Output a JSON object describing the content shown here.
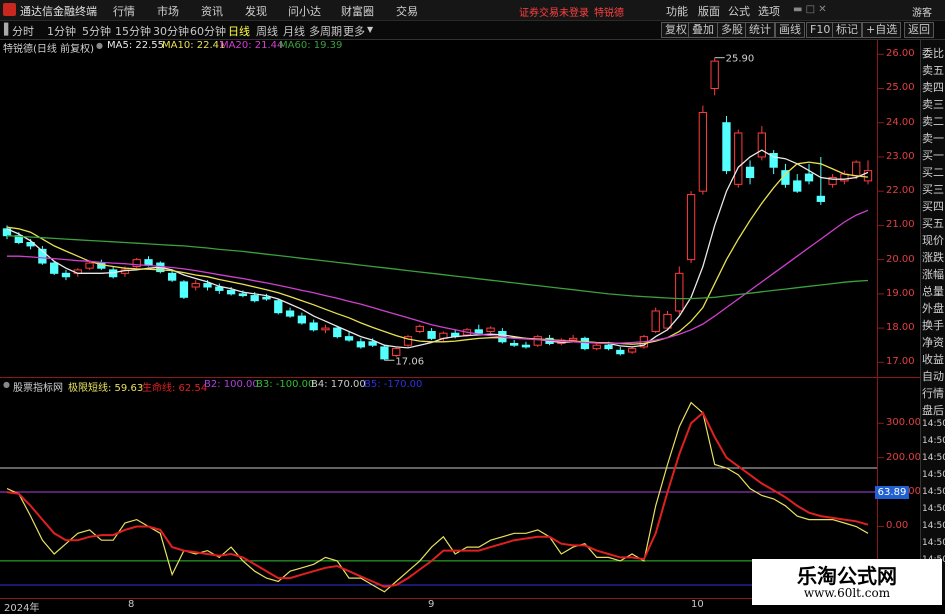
{
  "app": {
    "title": "通达信金融终端",
    "menu": [
      "行情",
      "市场",
      "资讯",
      "发现",
      "问小达",
      "财富圈",
      "交易"
    ],
    "notice": "证券交易未登录",
    "stock_name": "特锐德",
    "right_menu": [
      "功能",
      "版面",
      "公式",
      "选项"
    ],
    "guest": "游客"
  },
  "toolbar": {
    "periods": [
      "分时",
      "1分钟",
      "5分钟",
      "15分钟",
      "30分钟",
      "60分钟",
      "日线",
      "周线",
      "月线",
      "多周期",
      "更多"
    ],
    "active_period": "日线",
    "buttons": [
      "复权",
      "叠加",
      "多股",
      "统计",
      "画线",
      "F10",
      "标记",
      "+自选",
      "返回"
    ]
  },
  "main_header": {
    "title": "特锐德(日线 前复权)",
    "ma5": "MA5: 22.55",
    "ma10": "MA10: 22.41",
    "ma20": "MA20: 21.44",
    "ma60": "MA60: 19.39"
  },
  "sub_header": {
    "title": "股票指标网",
    "l1": "极限短线: 59.63",
    "l2": "生命线: 62.54",
    "l3": "B2: 100.00",
    "l4": "B3: -100.00",
    "l5": "B4: 170.00",
    "l6": "B5: -170.00"
  },
  "price_axis": [
    "26.00",
    "25.00",
    "24.00",
    "23.00",
    "22.00",
    "21.00",
    "20.00",
    "19.00",
    "18.00",
    "17.00"
  ],
  "indicator_axis": [
    "300.00",
    "200.00",
    "100.00",
    "0.00"
  ],
  "indicator_badge": "63.89",
  "time_axis": [
    "2024年",
    "8",
    "9",
    "10"
  ],
  "right_panel": [
    "委比",
    "卖五",
    "卖四",
    "卖三",
    "卖二",
    "卖一",
    "买一",
    "买二",
    "买三",
    "买四",
    "买五",
    "现价",
    "涨跌",
    "涨幅",
    "总量",
    "外盘",
    "换手",
    "净资",
    "收益",
    "自动",
    "行情",
    "盘后",
    "14:50",
    "14:50",
    "14:50",
    "14:50",
    "14:50",
    "14:50",
    "14:50",
    "14:50",
    "14:50"
  ],
  "price_labels": {
    "high": "25.90",
    "low": "17.06"
  },
  "watermark": {
    "title": "乐淘公式网",
    "url": "www.60lt.com"
  },
  "chart_data": [
    {
      "type": "candlestick",
      "title": "特锐德(日线 前复权)",
      "ylim": [
        16.6,
        26.3
      ],
      "x": [
        "d1",
        "d2",
        "d3",
        "d4",
        "d5",
        "d6",
        "d7",
        "d8",
        "d9",
        "d10",
        "d11",
        "d12",
        "d13",
        "d14",
        "d15",
        "d16",
        "d17",
        "d18",
        "d19",
        "d20",
        "d21",
        "d22",
        "d23",
        "d24",
        "d25",
        "d26",
        "d27",
        "d28",
        "d29",
        "d30",
        "d31",
        "d32",
        "d33",
        "d34",
        "d35",
        "d36",
        "d37",
        "d38",
        "d39",
        "d40",
        "d41",
        "d42",
        "d43",
        "d44",
        "d45",
        "d46",
        "d47",
        "d48",
        "d49",
        "d50",
        "d51",
        "d52",
        "d53",
        "d54",
        "d55",
        "d56",
        "d57",
        "d58",
        "d59",
        "d60",
        "d61",
        "d62",
        "d63",
        "d64",
        "d65",
        "d66",
        "d67",
        "d68",
        "d69",
        "d70",
        "d71",
        "d72",
        "d73",
        "d74"
      ],
      "ohlc": [
        [
          20.9,
          21.0,
          20.6,
          20.7
        ],
        [
          20.7,
          20.8,
          20.45,
          20.5
        ],
        [
          20.5,
          20.6,
          20.3,
          20.4
        ],
        [
          20.3,
          20.4,
          19.85,
          19.9
        ],
        [
          19.9,
          19.95,
          19.55,
          19.6
        ],
        [
          19.6,
          19.7,
          19.4,
          19.5
        ],
        [
          19.6,
          19.75,
          19.5,
          19.7
        ],
        [
          19.75,
          19.95,
          19.7,
          19.9
        ],
        [
          19.9,
          20.0,
          19.7,
          19.75
        ],
        [
          19.7,
          19.8,
          19.45,
          19.5
        ],
        [
          19.6,
          19.8,
          19.5,
          19.7
        ],
        [
          19.8,
          20.05,
          19.75,
          20.0
        ],
        [
          20.0,
          20.1,
          19.8,
          19.85
        ],
        [
          19.9,
          19.95,
          19.6,
          19.65
        ],
        [
          19.6,
          19.7,
          19.35,
          19.4
        ],
        [
          19.35,
          19.4,
          18.85,
          18.9
        ],
        [
          19.2,
          19.4,
          19.1,
          19.3
        ],
        [
          19.3,
          19.4,
          19.1,
          19.2
        ],
        [
          19.2,
          19.3,
          19.0,
          19.1
        ],
        [
          19.1,
          19.2,
          18.95,
          19.0
        ],
        [
          19.0,
          19.1,
          18.9,
          18.95
        ],
        [
          18.95,
          19.05,
          18.75,
          18.8
        ],
        [
          18.9,
          19.0,
          18.8,
          18.85
        ],
        [
          18.8,
          18.85,
          18.4,
          18.45
        ],
        [
          18.5,
          18.6,
          18.3,
          18.35
        ],
        [
          18.35,
          18.45,
          18.1,
          18.15
        ],
        [
          18.15,
          18.25,
          17.9,
          17.95
        ],
        [
          17.95,
          18.1,
          17.85,
          18.0
        ],
        [
          18.0,
          18.05,
          17.7,
          17.75
        ],
        [
          17.75,
          17.9,
          17.6,
          17.65
        ],
        [
          17.6,
          17.7,
          17.4,
          17.45
        ],
        [
          17.6,
          17.7,
          17.45,
          17.5
        ],
        [
          17.45,
          17.5,
          17.06,
          17.1
        ],
        [
          17.2,
          17.45,
          17.15,
          17.4
        ],
        [
          17.5,
          17.8,
          17.45,
          17.75
        ],
        [
          17.9,
          18.1,
          17.85,
          18.05
        ],
        [
          17.9,
          18.0,
          17.65,
          17.7
        ],
        [
          17.7,
          17.9,
          17.6,
          17.85
        ],
        [
          17.85,
          17.95,
          17.7,
          17.75
        ],
        [
          17.8,
          18.0,
          17.75,
          17.95
        ],
        [
          17.95,
          18.1,
          17.8,
          17.85
        ],
        [
          17.9,
          18.05,
          17.85,
          18.0
        ],
        [
          17.9,
          18.0,
          17.55,
          17.6
        ],
        [
          17.55,
          17.65,
          17.45,
          17.5
        ],
        [
          17.5,
          17.6,
          17.4,
          17.45
        ],
        [
          17.5,
          17.8,
          17.45,
          17.75
        ],
        [
          17.7,
          17.8,
          17.5,
          17.55
        ],
        [
          17.55,
          17.7,
          17.5,
          17.65
        ],
        [
          17.65,
          17.8,
          17.6,
          17.7
        ],
        [
          17.7,
          17.75,
          17.35,
          17.4
        ],
        [
          17.4,
          17.55,
          17.35,
          17.5
        ],
        [
          17.5,
          17.6,
          17.35,
          17.4
        ],
        [
          17.35,
          17.45,
          17.2,
          17.25
        ],
        [
          17.3,
          17.45,
          17.25,
          17.4
        ],
        [
          17.45,
          17.8,
          17.4,
          17.75
        ],
        [
          17.9,
          18.6,
          17.85,
          18.5
        ],
        [
          18.0,
          18.5,
          17.95,
          18.4
        ],
        [
          18.5,
          19.8,
          18.4,
          19.6
        ],
        [
          20.0,
          22.0,
          19.9,
          21.9
        ],
        [
          22.0,
          24.5,
          21.9,
          24.3
        ],
        [
          25.0,
          25.9,
          24.8,
          25.8
        ],
        [
          24.0,
          24.2,
          22.5,
          22.6
        ],
        [
          22.2,
          23.8,
          22.1,
          23.7
        ],
        [
          22.7,
          22.9,
          22.2,
          22.4
        ],
        [
          23.0,
          23.9,
          22.9,
          23.7
        ],
        [
          23.1,
          23.2,
          22.5,
          22.7
        ],
        [
          22.6,
          22.8,
          22.1,
          22.2
        ],
        [
          22.3,
          22.5,
          21.95,
          22.0
        ],
        [
          22.5,
          22.8,
          22.2,
          22.3
        ],
        [
          21.85,
          23.0,
          21.6,
          21.7
        ],
        [
          22.2,
          22.5,
          22.1,
          22.4
        ],
        [
          22.3,
          22.6,
          22.2,
          22.5
        ],
        [
          22.45,
          22.9,
          22.35,
          22.85
        ],
        [
          22.3,
          22.9,
          22.2,
          22.6
        ]
      ],
      "series": [
        {
          "name": "MA5",
          "color": "#e8e8e8",
          "values": [
            20.9,
            20.75,
            20.55,
            20.25,
            19.95,
            19.75,
            19.6,
            19.6,
            19.6,
            19.62,
            19.68,
            19.7,
            19.75,
            19.78,
            19.7,
            19.55,
            19.45,
            19.35,
            19.22,
            19.15,
            19.05,
            19.0,
            18.95,
            18.85,
            18.7,
            18.55,
            18.35,
            18.2,
            18.05,
            17.9,
            17.75,
            17.65,
            17.5,
            17.45,
            17.42,
            17.5,
            17.58,
            17.7,
            17.75,
            17.78,
            17.8,
            17.82,
            17.8,
            17.75,
            17.7,
            17.67,
            17.62,
            17.58,
            17.6,
            17.6,
            17.57,
            17.55,
            17.48,
            17.45,
            17.5,
            17.75,
            17.95,
            18.35,
            18.9,
            19.8,
            21.0,
            22.0,
            22.7,
            23.0,
            23.2,
            23.0,
            22.95,
            22.8,
            22.6,
            22.4,
            22.35,
            22.35,
            22.4,
            22.55
          ]
        },
        {
          "name": "MA10",
          "color": "#e8e050",
          "values": [
            20.95,
            20.9,
            20.8,
            20.6,
            20.4,
            20.25,
            20.1,
            19.95,
            19.85,
            19.8,
            19.75,
            19.73,
            19.72,
            19.7,
            19.68,
            19.62,
            19.55,
            19.5,
            19.42,
            19.35,
            19.28,
            19.2,
            19.12,
            19.03,
            18.92,
            18.8,
            18.68,
            18.55,
            18.42,
            18.3,
            18.15,
            18.02,
            17.9,
            17.78,
            17.68,
            17.62,
            17.6,
            17.6,
            17.62,
            17.66,
            17.7,
            17.72,
            17.72,
            17.72,
            17.7,
            17.68,
            17.66,
            17.63,
            17.62,
            17.6,
            17.58,
            17.57,
            17.55,
            17.53,
            17.55,
            17.62,
            17.72,
            17.9,
            18.2,
            18.6,
            19.3,
            20.0,
            20.6,
            21.15,
            21.65,
            22.1,
            22.5,
            22.8,
            22.85,
            22.8,
            22.65,
            22.5,
            22.45,
            22.41
          ]
        },
        {
          "name": "MA20",
          "color": "#d040d0",
          "values": [
            20.1,
            20.1,
            20.08,
            20.05,
            20.03,
            20.0,
            19.97,
            19.95,
            19.92,
            19.9,
            19.88,
            19.85,
            19.83,
            19.8,
            19.77,
            19.73,
            19.68,
            19.62,
            19.56,
            19.5,
            19.45,
            19.38,
            19.32,
            19.25,
            19.18,
            19.1,
            19.03,
            18.95,
            18.87,
            18.78,
            18.7,
            18.6,
            18.5,
            18.4,
            18.3,
            18.2,
            18.1,
            18.02,
            17.95,
            17.88,
            17.82,
            17.78,
            17.74,
            17.7,
            17.68,
            17.66,
            17.64,
            17.62,
            17.6,
            17.58,
            17.56,
            17.55,
            17.56,
            17.58,
            17.6,
            17.65,
            17.72,
            17.82,
            17.95,
            18.12,
            18.35,
            18.6,
            18.85,
            19.1,
            19.35,
            19.6,
            19.85,
            20.1,
            20.35,
            20.6,
            20.85,
            21.1,
            21.3,
            21.44
          ]
        },
        {
          "name": "MA60",
          "color": "#3ca03c",
          "values": [
            20.7,
            20.68,
            20.66,
            20.64,
            20.62,
            20.6,
            20.58,
            20.56,
            20.54,
            20.52,
            20.5,
            20.48,
            20.46,
            20.44,
            20.42,
            20.4,
            20.37,
            20.34,
            20.3,
            20.27,
            20.24,
            20.2,
            20.16,
            20.12,
            20.08,
            20.04,
            20.0,
            19.96,
            19.92,
            19.88,
            19.84,
            19.8,
            19.76,
            19.72,
            19.68,
            19.64,
            19.6,
            19.56,
            19.52,
            19.48,
            19.44,
            19.4,
            19.36,
            19.32,
            19.28,
            19.24,
            19.2,
            19.16,
            19.12,
            19.08,
            19.04,
            19.0,
            18.97,
            18.94,
            18.92,
            18.9,
            18.88,
            18.86,
            18.86,
            18.88,
            18.9,
            18.94,
            18.98,
            19.02,
            19.06,
            19.1,
            19.14,
            19.18,
            19.22,
            19.26,
            19.3,
            19.34,
            19.37,
            19.39
          ]
        }
      ]
    },
    {
      "type": "line",
      "title": "股票指标网",
      "ylim": [
        -205,
        385
      ],
      "hlines": [
        {
          "name": "B4",
          "value": 170,
          "color": "#c8c8c8"
        },
        {
          "name": "B2",
          "value": 100,
          "color": "#b040e0"
        },
        {
          "name": "B3",
          "value": -100,
          "color": "#30c030"
        },
        {
          "name": "B5",
          "value": -170,
          "color": "#3030e0"
        }
      ],
      "series": [
        {
          "name": "极限短线",
          "color": "#e8e060",
          "values": [
            110,
            95,
            30,
            -40,
            -80,
            -50,
            -20,
            -10,
            -40,
            -40,
            10,
            20,
            0,
            -20,
            -140,
            -70,
            -80,
            -70,
            -90,
            -60,
            -100,
            -130,
            -150,
            -160,
            -130,
            -120,
            -110,
            -90,
            -100,
            -150,
            -150,
            -170,
            -190,
            -160,
            -130,
            -100,
            -60,
            -30,
            -80,
            -60,
            -60,
            -40,
            -30,
            -20,
            -20,
            -10,
            -30,
            -80,
            -60,
            -50,
            -90,
            -90,
            -100,
            -80,
            -100,
            60,
            180,
            290,
            360,
            330,
            180,
            170,
            150,
            110,
            90,
            80,
            60,
            30,
            20,
            20,
            20,
            10,
            0,
            -20
          ]
        },
        {
          "name": "生命线",
          "color": "#e02020",
          "values": [
            100,
            95,
            60,
            20,
            -20,
            -40,
            -40,
            -30,
            -25,
            -25,
            -10,
            0,
            0,
            -10,
            -60,
            -70,
            -75,
            -80,
            -85,
            -80,
            -90,
            -110,
            -130,
            -150,
            -150,
            -140,
            -130,
            -120,
            -115,
            -130,
            -145,
            -160,
            -175,
            -170,
            -150,
            -125,
            -100,
            -70,
            -70,
            -70,
            -70,
            -60,
            -50,
            -40,
            -35,
            -30,
            -30,
            -50,
            -55,
            -55,
            -70,
            -80,
            -90,
            -90,
            -95,
            -20,
            100,
            210,
            300,
            330,
            260,
            200,
            175,
            150,
            125,
            105,
            85,
            60,
            40,
            30,
            25,
            20,
            15,
            5
          ]
        }
      ]
    }
  ]
}
